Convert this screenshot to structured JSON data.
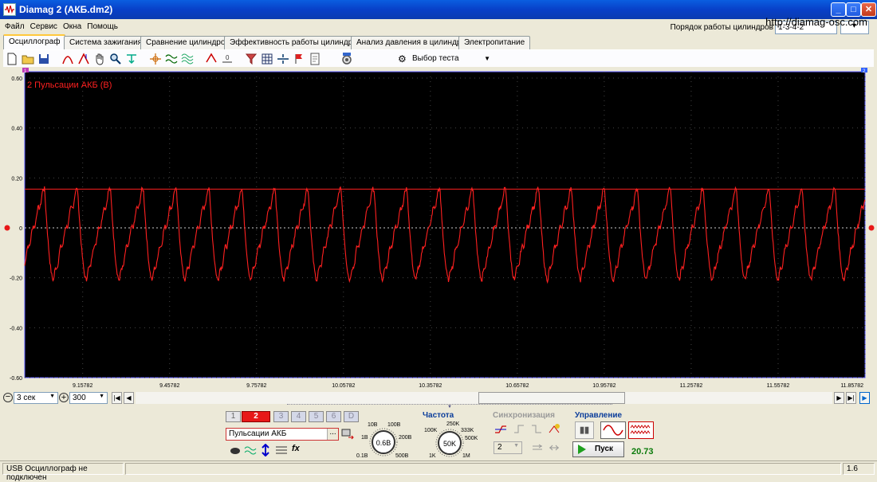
{
  "window": {
    "title": "Diamag 2 (АКБ.dm2)",
    "url": "http://diamag-osc.com"
  },
  "menu": [
    "Файл",
    "Сервис",
    "Окна",
    "Помощь"
  ],
  "firing_order": {
    "label": "Порядок работы цилиндров",
    "value": "1-3-4-2"
  },
  "tabs": [
    "Осциллограф",
    "Система зажигания",
    "Сравнение цилиндров",
    "Эффективность работы цилиндров",
    "Анализ давления в цилиндре",
    "Электропитание"
  ],
  "toolbar": {
    "test_select": "Выбор теста"
  },
  "scope": {
    "channel_label": "2 Пульсации АКБ (В)",
    "trace_color": "#ff2020",
    "marker_left": "1",
    "marker_right": "2"
  },
  "chart_data": {
    "type": "line",
    "title": "2 Пульсации АКБ (В)",
    "xlabel": "",
    "ylabel": "",
    "y_ticks": [
      "0.60",
      "0.40",
      "0.20",
      "0",
      "-0.20",
      "-0.40",
      "-0.60"
    ],
    "x_ticks": [
      "9.15782",
      "9.45782",
      "9.75782",
      "10.05782",
      "10.35782",
      "10.65782",
      "10.95782",
      "11.25782",
      "11.55782",
      "11.85782"
    ],
    "ylim": [
      -0.6,
      0.6
    ],
    "xlim": [
      8.9578,
      11.8578
    ],
    "grid": true,
    "reference_level": 0.155,
    "series": [
      {
        "period_s": 0.1137,
        "peak": 0.16,
        "trough": -0.21,
        "start_x": 8.9578
      }
    ]
  },
  "bottom": {
    "timebase": "3 сек",
    "samples": "300",
    "channels": [
      "1",
      "2",
      "3",
      "4",
      "5",
      "6",
      "D"
    ],
    "active_channel": "2",
    "channel_name": "Пульсации АКБ",
    "voltage": {
      "value": "0.6В",
      "marks": [
        "10В",
        "100В",
        "1В",
        "200В",
        "0.1В",
        "500В"
      ]
    },
    "frequency": {
      "title": "Частота",
      "value": "50K",
      "marks": [
        "250K",
        "100K",
        "333K",
        "500K",
        "1K",
        "1M"
      ]
    },
    "sync": {
      "title": "Синхронизация",
      "value": "2"
    },
    "control": {
      "title": "Управление",
      "start": "Пуск",
      "reading": "20.73"
    }
  },
  "status": {
    "message": "USB Осциллограф не подключен",
    "version": "1.6"
  }
}
